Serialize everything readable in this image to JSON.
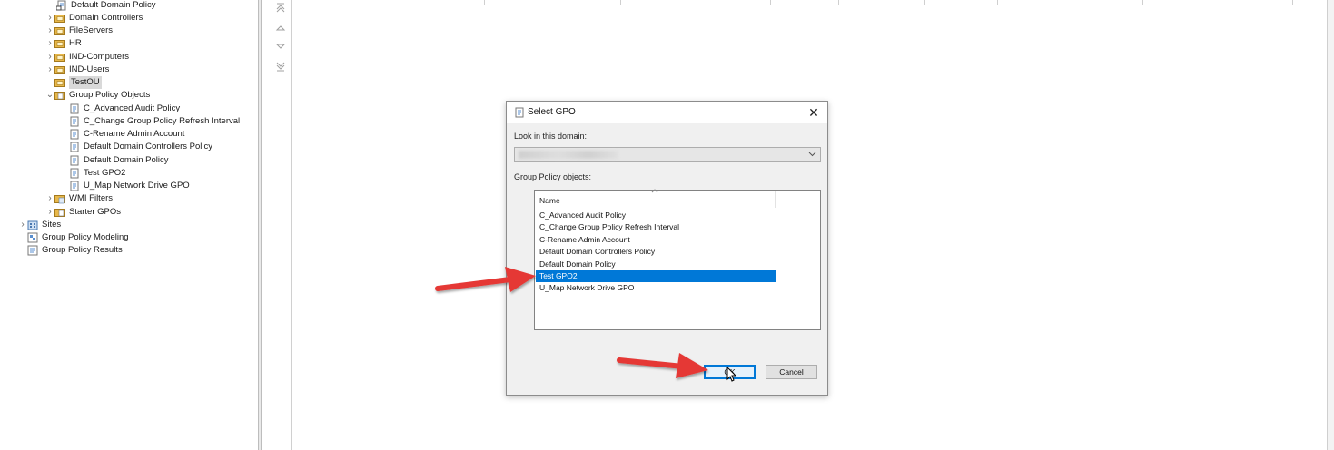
{
  "tree": {
    "items": [
      {
        "label": "Default Domain Policy",
        "icon": "gpo-link-icon",
        "chevron": ""
      },
      {
        "label": "Domain Controllers",
        "icon": "ou-folder-icon",
        "chevron": "›"
      },
      {
        "label": "FileServers",
        "icon": "ou-folder-icon",
        "chevron": "›"
      },
      {
        "label": "HR",
        "icon": "ou-folder-icon",
        "chevron": "›"
      },
      {
        "label": "IND-Computers",
        "icon": "ou-folder-icon",
        "chevron": "›"
      },
      {
        "label": "IND-Users",
        "icon": "ou-folder-icon",
        "chevron": "›"
      },
      {
        "label": "TestOU",
        "icon": "ou-folder-icon",
        "chevron": ""
      },
      {
        "label": "Group Policy Objects",
        "icon": "gpo-folder-icon",
        "chevron": "⌄"
      },
      {
        "label": "C_Advanced Audit Policy",
        "icon": "gpo-icon",
        "chevron": ""
      },
      {
        "label": "C_Change Group Policy Refresh Interval",
        "icon": "gpo-icon",
        "chevron": ""
      },
      {
        "label": "C-Rename Admin Account",
        "icon": "gpo-icon",
        "chevron": ""
      },
      {
        "label": "Default Domain Controllers Policy",
        "icon": "gpo-icon",
        "chevron": ""
      },
      {
        "label": "Default Domain Policy",
        "icon": "gpo-icon",
        "chevron": ""
      },
      {
        "label": "Test GPO2",
        "icon": "gpo-icon",
        "chevron": ""
      },
      {
        "label": "U_Map Network Drive GPO",
        "icon": "gpo-icon",
        "chevron": ""
      },
      {
        "label": "WMI Filters",
        "icon": "wmi-folder-icon",
        "chevron": "›"
      },
      {
        "label": "Starter GPOs",
        "icon": "starter-folder-icon",
        "chevron": "›"
      },
      {
        "label": "Sites",
        "icon": "sites-icon",
        "chevron": "›"
      },
      {
        "label": "Group Policy Modeling",
        "icon": "modeling-icon",
        "chevron": ""
      },
      {
        "label": "Group Policy Results",
        "icon": "results-icon",
        "chevron": ""
      }
    ],
    "selected": "TestOU"
  },
  "reorder": {
    "icons": [
      "move-top-icon",
      "move-up-icon",
      "move-down-icon",
      "move-bottom-icon"
    ]
  },
  "dialog": {
    "title": "Select GPO",
    "close_glyph": "✕",
    "domain_label": "Look in this domain:",
    "domain_value": "",
    "gpo_label": "Group Policy objects:",
    "column_name": "Name",
    "items": [
      "C_Advanced Audit Policy",
      "C_Change Group Policy Refresh Interval",
      "C-Rename Admin Account",
      "Default Domain Controllers Policy",
      "Default Domain Policy",
      "Test GPO2",
      "U_Map Network Drive GPO"
    ],
    "selected_item": "Test GPO2",
    "ok_label": "OK",
    "cancel_label": "Cancel"
  },
  "colors": {
    "selection": "#0078d7",
    "annotation_arrow": "#e53935",
    "folder": "#e8b84a"
  }
}
